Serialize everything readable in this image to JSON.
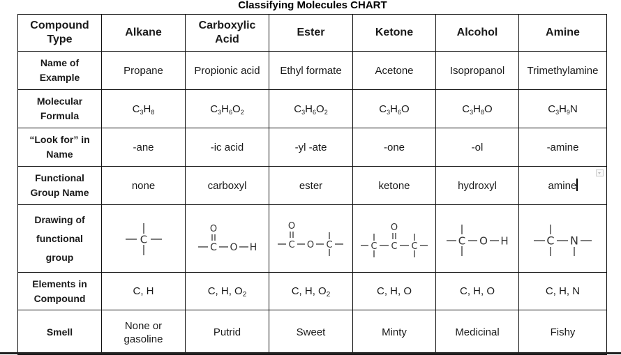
{
  "title": "Classifying Molecules CHART",
  "header_row": {
    "label": "Compound Type",
    "label_lines": [
      "Compound",
      "Type"
    ],
    "columns": [
      "Alkane",
      "Carboxylic Acid",
      "Ester",
      "Ketone",
      "Alcohol",
      "Amine"
    ],
    "columns_lines": [
      [
        "Alkane"
      ],
      [
        "Carboxylic",
        "Acid"
      ],
      [
        "Ester"
      ],
      [
        "Ketone"
      ],
      [
        "Alcohol"
      ],
      [
        "Amine"
      ]
    ]
  },
  "rows": {
    "example_name": {
      "label_lines": [
        "Name of",
        "Example"
      ],
      "values": [
        "Propane",
        "Propionic acid",
        "Ethyl formate",
        "Acetone",
        "Isopropanol",
        "Trimethylamine"
      ]
    },
    "molecular_formula": {
      "label_lines": [
        "Molecular",
        "Formula"
      ],
      "values": [
        [
          [
            "C",
            ""
          ],
          [
            "3",
            "sub"
          ],
          [
            "H",
            ""
          ],
          [
            "8",
            "sub"
          ]
        ],
        [
          [
            "C",
            ""
          ],
          [
            "3",
            "sub"
          ],
          [
            "H",
            ""
          ],
          [
            "6",
            "sub"
          ],
          [
            "O",
            ""
          ],
          [
            "2",
            "sub"
          ]
        ],
        [
          [
            "C",
            ""
          ],
          [
            "3",
            "sub"
          ],
          [
            "H",
            ""
          ],
          [
            "6",
            "sub"
          ],
          [
            "O",
            ""
          ],
          [
            "2",
            "sub"
          ]
        ],
        [
          [
            "C",
            ""
          ],
          [
            "3",
            "sub"
          ],
          [
            "H",
            ""
          ],
          [
            "6",
            "sub"
          ],
          [
            "O",
            ""
          ]
        ],
        [
          [
            "C",
            ""
          ],
          [
            "3",
            "sub"
          ],
          [
            "H",
            ""
          ],
          [
            "8",
            "sub"
          ],
          [
            "O",
            ""
          ]
        ],
        [
          [
            "C",
            ""
          ],
          [
            "3",
            "sub"
          ],
          [
            "H",
            ""
          ],
          [
            "9",
            "sub"
          ],
          [
            "N",
            ""
          ]
        ]
      ],
      "values_text": [
        "C3H8",
        "C3H6O2",
        "C3H6O2",
        "C3H6O",
        "C3H8O",
        "C3H9N"
      ]
    },
    "look_for": {
      "label_lines": [
        "“Look for” in",
        "Name"
      ],
      "values": [
        "-ane",
        "-ic acid",
        "-yl -ate",
        "-one",
        "-ol",
        "-amine"
      ]
    },
    "functional_group_name": {
      "label_lines": [
        "Functional",
        "Group Name"
      ],
      "values": [
        "none",
        "carboxyl",
        "ester",
        "ketone",
        "hydroxyl",
        "amine"
      ]
    },
    "drawing": {
      "label_lines": [
        "Drawing of",
        "functional",
        "group"
      ],
      "values": [
        "alkane-structure",
        "carboxyl-structure",
        "ester-structure",
        "ketone-structure",
        "hydroxyl-structure",
        "amine-structure"
      ],
      "atoms": {
        "C": "C",
        "O": "O",
        "H": "H",
        "N": "N"
      }
    },
    "elements": {
      "label_lines": [
        "Elements in",
        "Compound"
      ],
      "values": [
        [
          [
            "C, H",
            ""
          ]
        ],
        [
          [
            "C, H, O",
            ""
          ],
          [
            "2",
            "sub"
          ]
        ],
        [
          [
            "C, H, O",
            ""
          ],
          [
            "2",
            "sub"
          ]
        ],
        [
          [
            "C, H, O",
            ""
          ]
        ],
        [
          [
            "C, H, O",
            ""
          ]
        ],
        [
          [
            "C, H, N",
            ""
          ]
        ]
      ]
    },
    "smell": {
      "label_lines": [
        "Smell"
      ],
      "values": [
        "None or gasoline",
        "Putrid",
        "Sweet",
        "Minty",
        "Medicinal",
        "Fishy"
      ],
      "alkane_lines": [
        "None or",
        "gasoline"
      ]
    }
  }
}
